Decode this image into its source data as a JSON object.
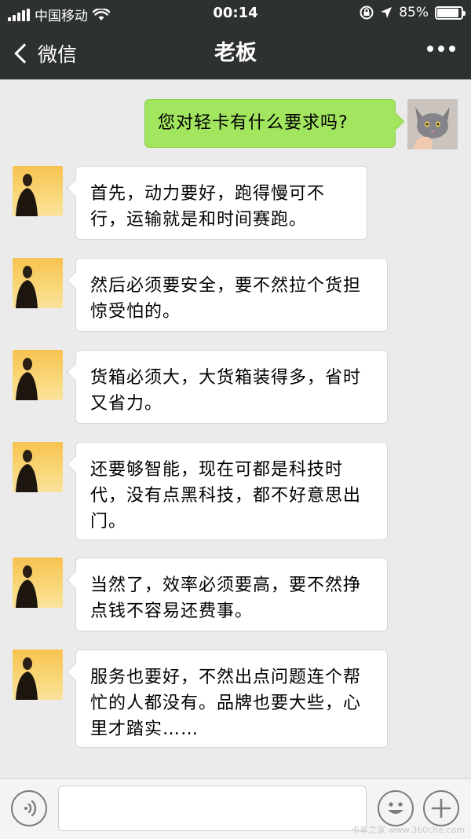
{
  "status_bar": {
    "carrier": "中国移动",
    "time": "00:14",
    "battery": "85%"
  },
  "nav": {
    "back_label": "微信",
    "title": "老板",
    "more_icon": "more-dots-icon"
  },
  "messages": [
    {
      "sender": "me",
      "text": "您对轻卡有什么要求吗?"
    },
    {
      "sender": "boss",
      "text": "首先，动力要好，跑得慢可不行，运输就是和时间赛跑。"
    },
    {
      "sender": "boss",
      "text": "然后必须要安全，要不然拉个货担惊受怕的。"
    },
    {
      "sender": "boss",
      "text": "货箱必须大，大货箱装得多，省时又省力。"
    },
    {
      "sender": "boss",
      "text": "还要够智能，现在可都是科技时代，没有点黑科技，都不好意思出门。"
    },
    {
      "sender": "boss",
      "text": "当然了，效率必须要高，要不然挣点钱不容易还费事。"
    },
    {
      "sender": "boss",
      "text": "服务也要好，不然出点问题连个帮忙的人都没有。品牌也要大些，心里才踏实……"
    }
  ],
  "input_bar": {
    "voice_icon": "voice-icon",
    "emoji_icon": "emoji-icon",
    "add_icon": "plus-icon",
    "text_value": ""
  },
  "watermark": "卡车之家 www.360che.com",
  "colors": {
    "header_bg": "#2e3132",
    "chat_bg": "#ebebeb",
    "my_bubble": "#a2e55f",
    "their_bubble": "#ffffff"
  }
}
